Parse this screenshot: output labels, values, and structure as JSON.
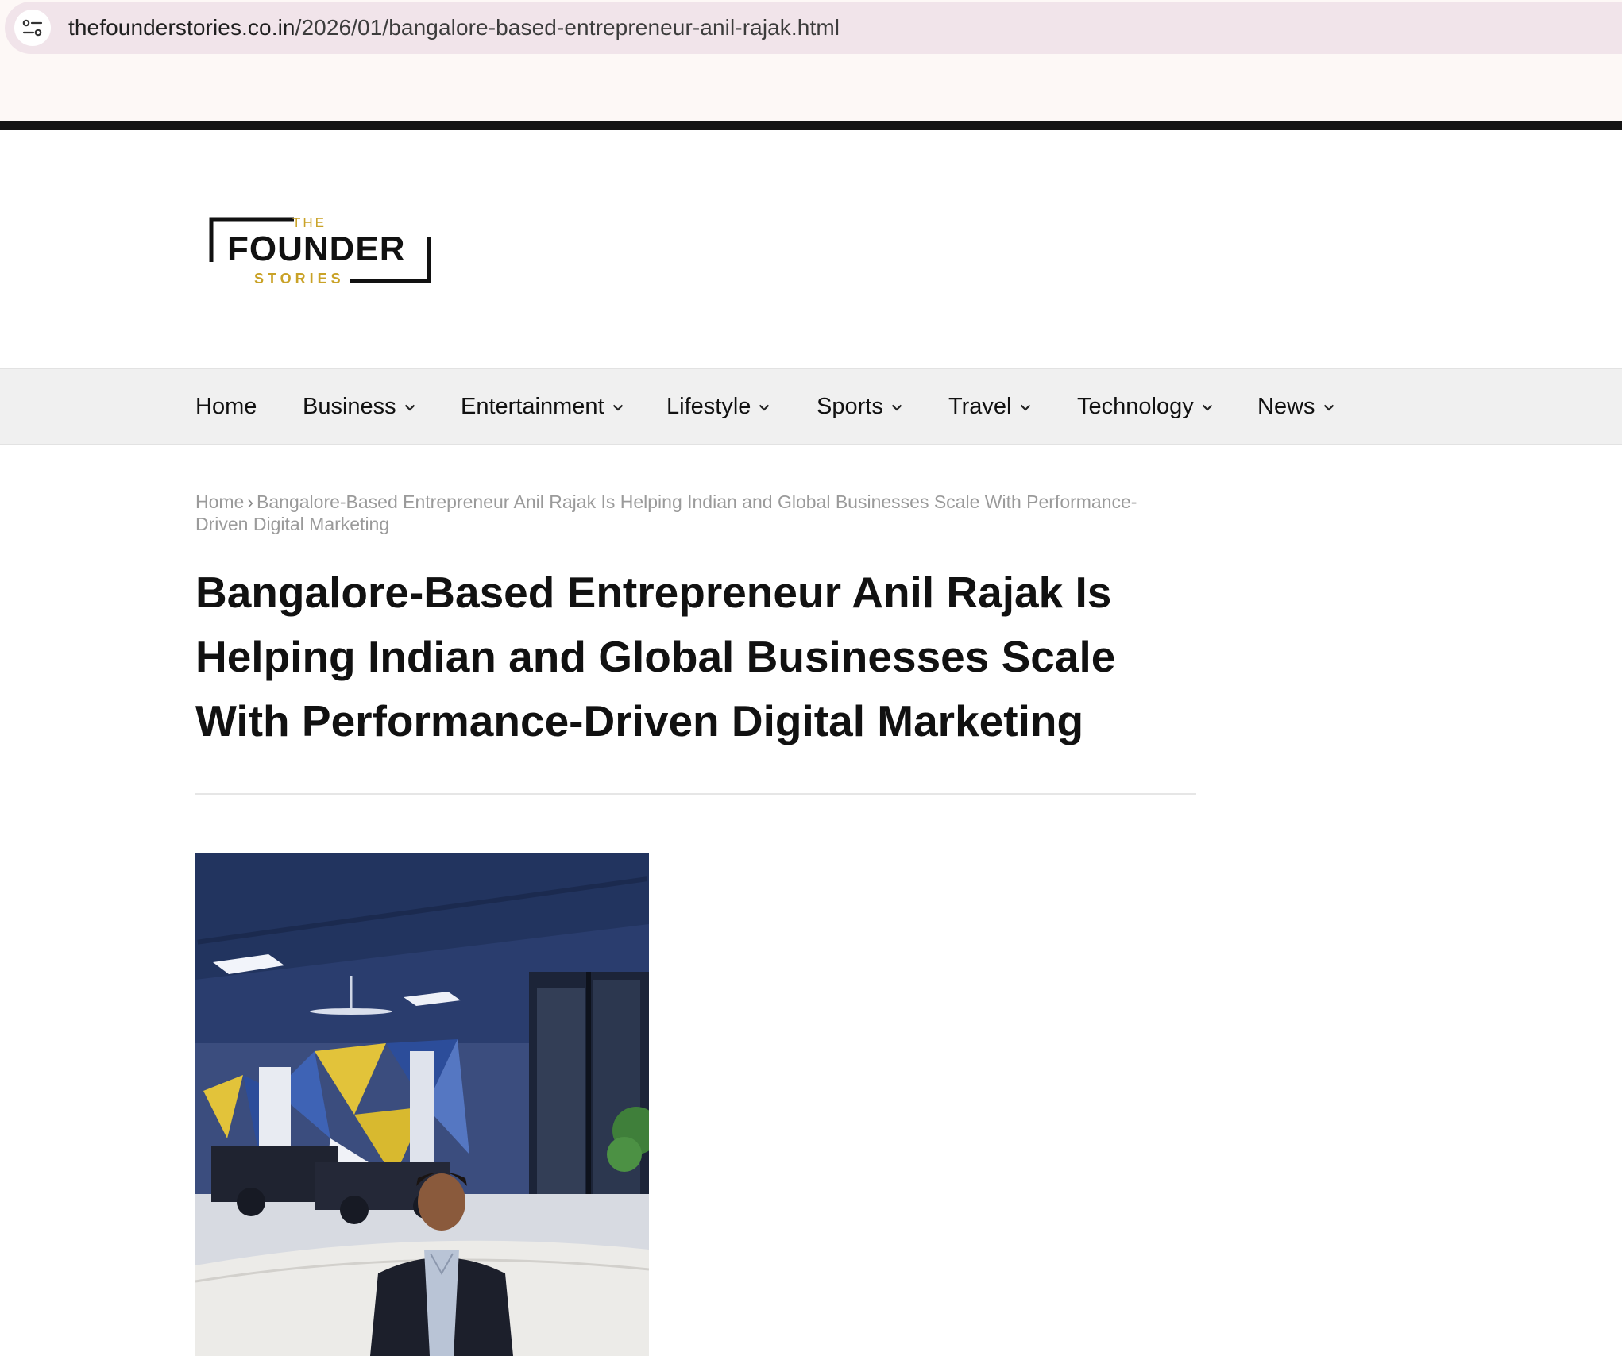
{
  "browser": {
    "url_domain": "thefounderstories.co.in",
    "url_path": "/2026/01/bangalore-based-entrepreneur-anil-rajak.html"
  },
  "logo": {
    "top": "THE",
    "main": "FOUNDER",
    "bottom": "STORIES",
    "accent_color": "#c9a227"
  },
  "nav": {
    "items": [
      {
        "label": "Home",
        "dropdown": false
      },
      {
        "label": "Business",
        "dropdown": true
      },
      {
        "label": "Entertainment",
        "dropdown": true
      },
      {
        "label": "Lifestyle",
        "dropdown": true
      },
      {
        "label": "Sports",
        "dropdown": true
      },
      {
        "label": "Travel",
        "dropdown": true
      },
      {
        "label": "Technology",
        "dropdown": true
      },
      {
        "label": "News",
        "dropdown": true
      }
    ]
  },
  "breadcrumb": {
    "home": "Home",
    "separator": "›",
    "current": "Bangalore-Based Entrepreneur Anil Rajak Is Helping Indian and Global Businesses Scale With Performance-Driven Digital Marketing"
  },
  "article": {
    "title": "Bangalore-Based Entrepreneur Anil Rajak Is Helping Indian and Global Businesses Scale With Performance-Driven Digital Marketing"
  }
}
